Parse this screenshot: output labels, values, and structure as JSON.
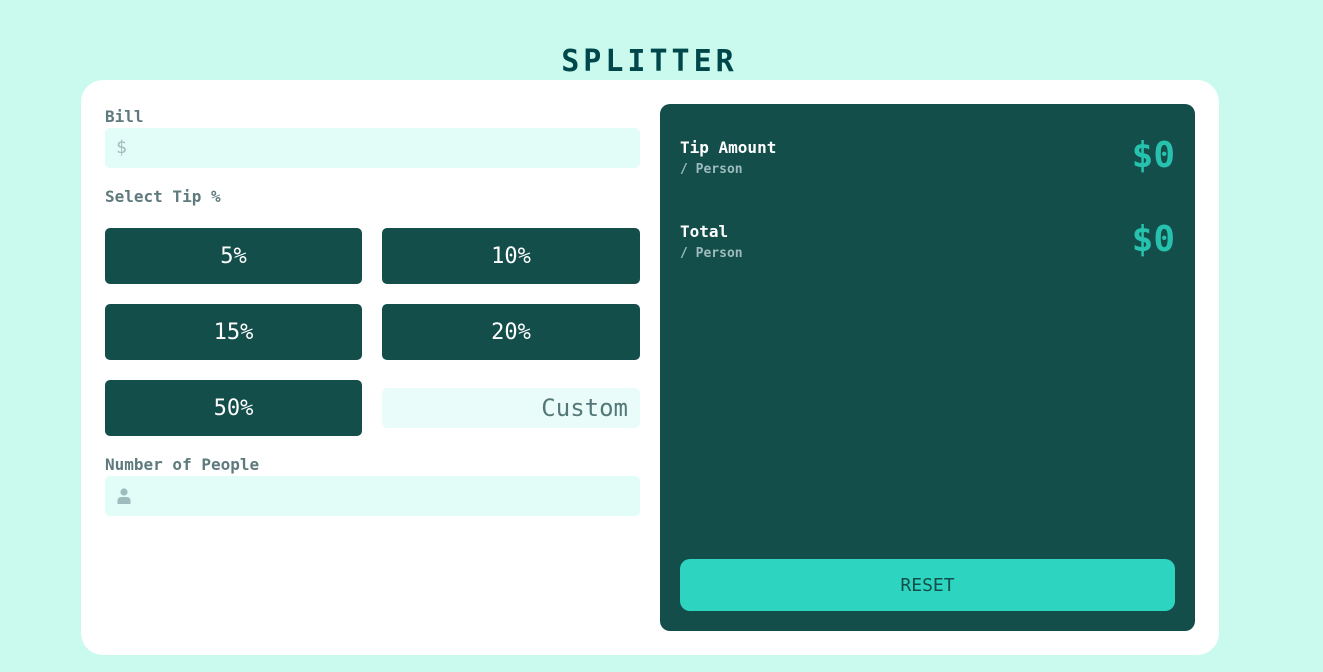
{
  "app": {
    "title": "SPLITTER"
  },
  "bill": {
    "label": "Bill",
    "currency_symbol": "$",
    "value": ""
  },
  "tip": {
    "label": "Select Tip %",
    "options": [
      "5%",
      "10%",
      "15%",
      "20%",
      "50%"
    ],
    "custom_placeholder": "Custom"
  },
  "people": {
    "label": "Number of People",
    "value": ""
  },
  "results": {
    "tip_amount_label": "Tip Amount",
    "tip_amount_sub": "/ Person",
    "tip_amount_value": "$0",
    "total_label": "Total",
    "total_sub": "/ Person",
    "total_value": "$0",
    "reset_label": "RESET"
  },
  "colors": {
    "background": "#cafaee",
    "panel": "#134e4b",
    "accent": "#26c2ae",
    "reset_button": "#2dd4bf",
    "input_bg": "#e2fcf8"
  }
}
